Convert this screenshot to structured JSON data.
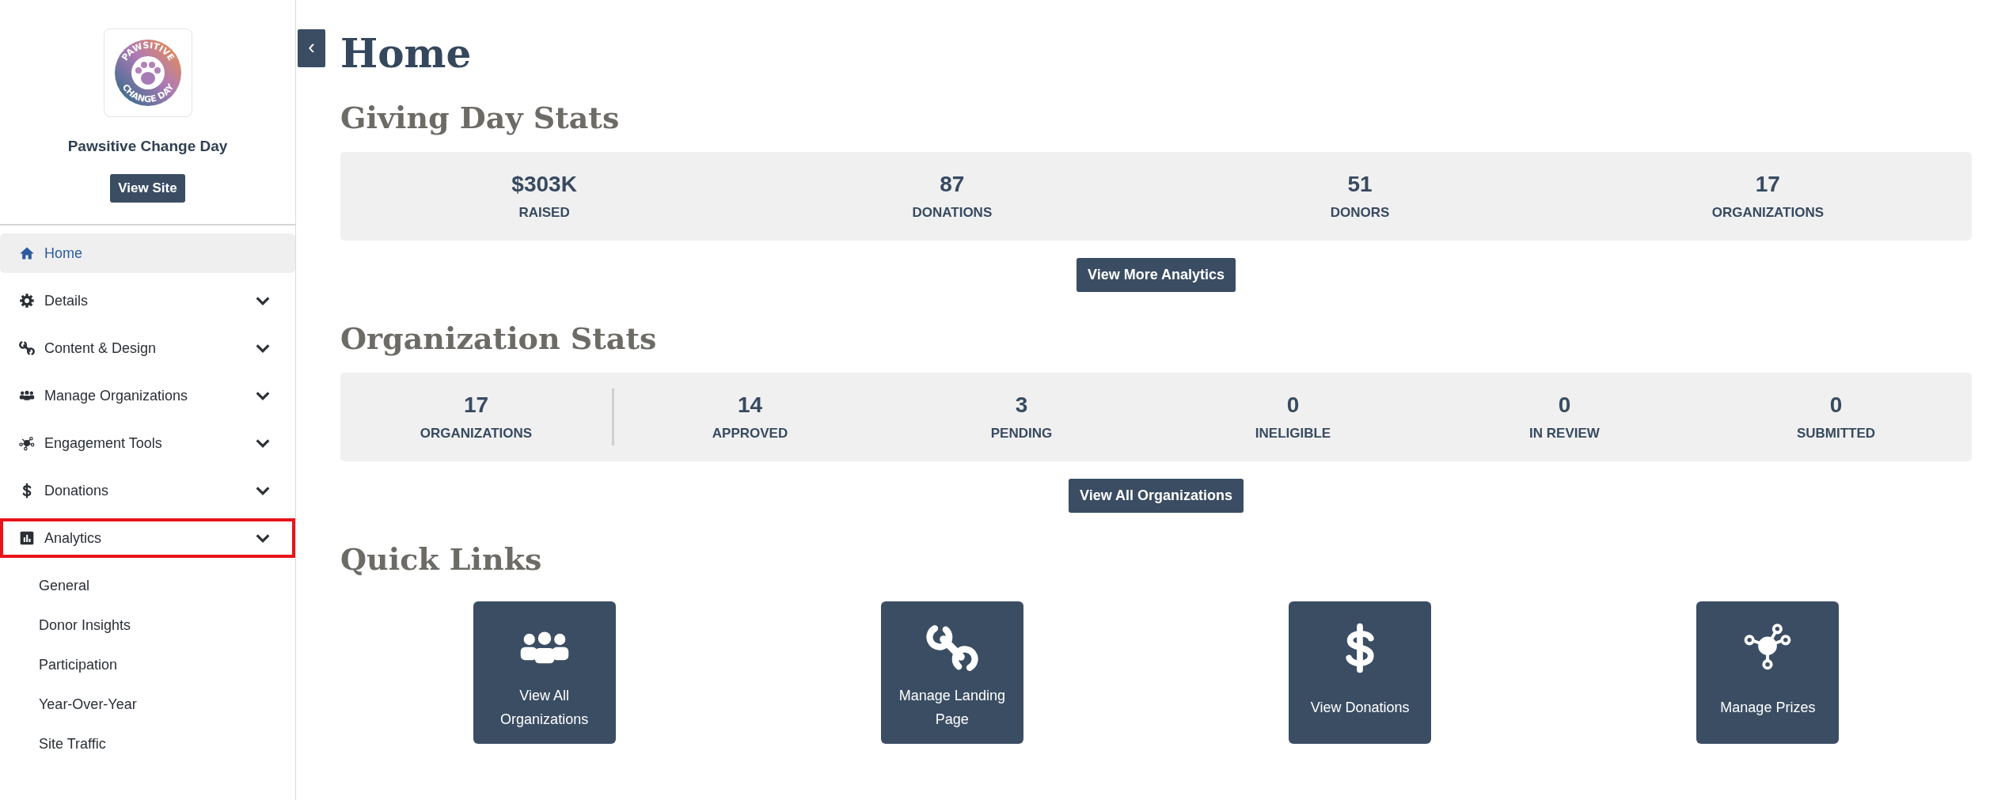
{
  "sidebar": {
    "logo": {
      "top_text": "PAWSITIVE",
      "bottom_text": "CHANGE DAY"
    },
    "site_name": "Pawsitive Change Day",
    "view_site_button": "View Site",
    "nav": [
      {
        "label": "Home",
        "kind": "link",
        "selected": true,
        "highlighted": false
      },
      {
        "label": "Details",
        "kind": "menu",
        "selected": false,
        "highlighted": false
      },
      {
        "label": "Content & Design",
        "kind": "menu",
        "selected": false,
        "highlighted": false
      },
      {
        "label": "Manage Organizations",
        "kind": "menu",
        "selected": false,
        "highlighted": false
      },
      {
        "label": "Engagement Tools",
        "kind": "menu",
        "selected": false,
        "highlighted": false
      },
      {
        "label": "Donations",
        "kind": "menu",
        "selected": false,
        "highlighted": false
      },
      {
        "label": "Analytics",
        "kind": "menu",
        "selected": false,
        "highlighted": true,
        "children": [
          {
            "label": "General"
          },
          {
            "label": "Donor Insights"
          },
          {
            "label": "Participation"
          },
          {
            "label": "Year-Over-Year"
          },
          {
            "label": "Site Traffic"
          }
        ]
      }
    ]
  },
  "page": {
    "collapse_button": "‹",
    "title": "Home",
    "giving_day_stats": {
      "title": "Giving Day Stats",
      "stats": [
        {
          "value": "$303K",
          "label": "RAISED"
        },
        {
          "value": "87",
          "label": "DONATIONS"
        },
        {
          "value": "51",
          "label": "DONORS"
        },
        {
          "value": "17",
          "label": "ORGANIZATIONS"
        }
      ],
      "button": "View More Analytics"
    },
    "organization_stats": {
      "title": "Organization Stats",
      "stats": [
        {
          "value": "17",
          "label": "ORGANIZATIONS"
        },
        {
          "value": "14",
          "label": "APPROVED"
        },
        {
          "value": "3",
          "label": "PENDING"
        },
        {
          "value": "0",
          "label": "INELIGIBLE"
        },
        {
          "value": "0",
          "label": "IN REVIEW"
        },
        {
          "value": "0",
          "label": "SUBMITTED"
        }
      ],
      "button": "View All Organizations"
    },
    "quick_links": {
      "title": "Quick Links",
      "items": [
        {
          "label": "View All Organizations"
        },
        {
          "label": "Manage Landing Page"
        },
        {
          "label": "View Donations"
        },
        {
          "label": "Manage Prizes"
        }
      ]
    }
  }
}
